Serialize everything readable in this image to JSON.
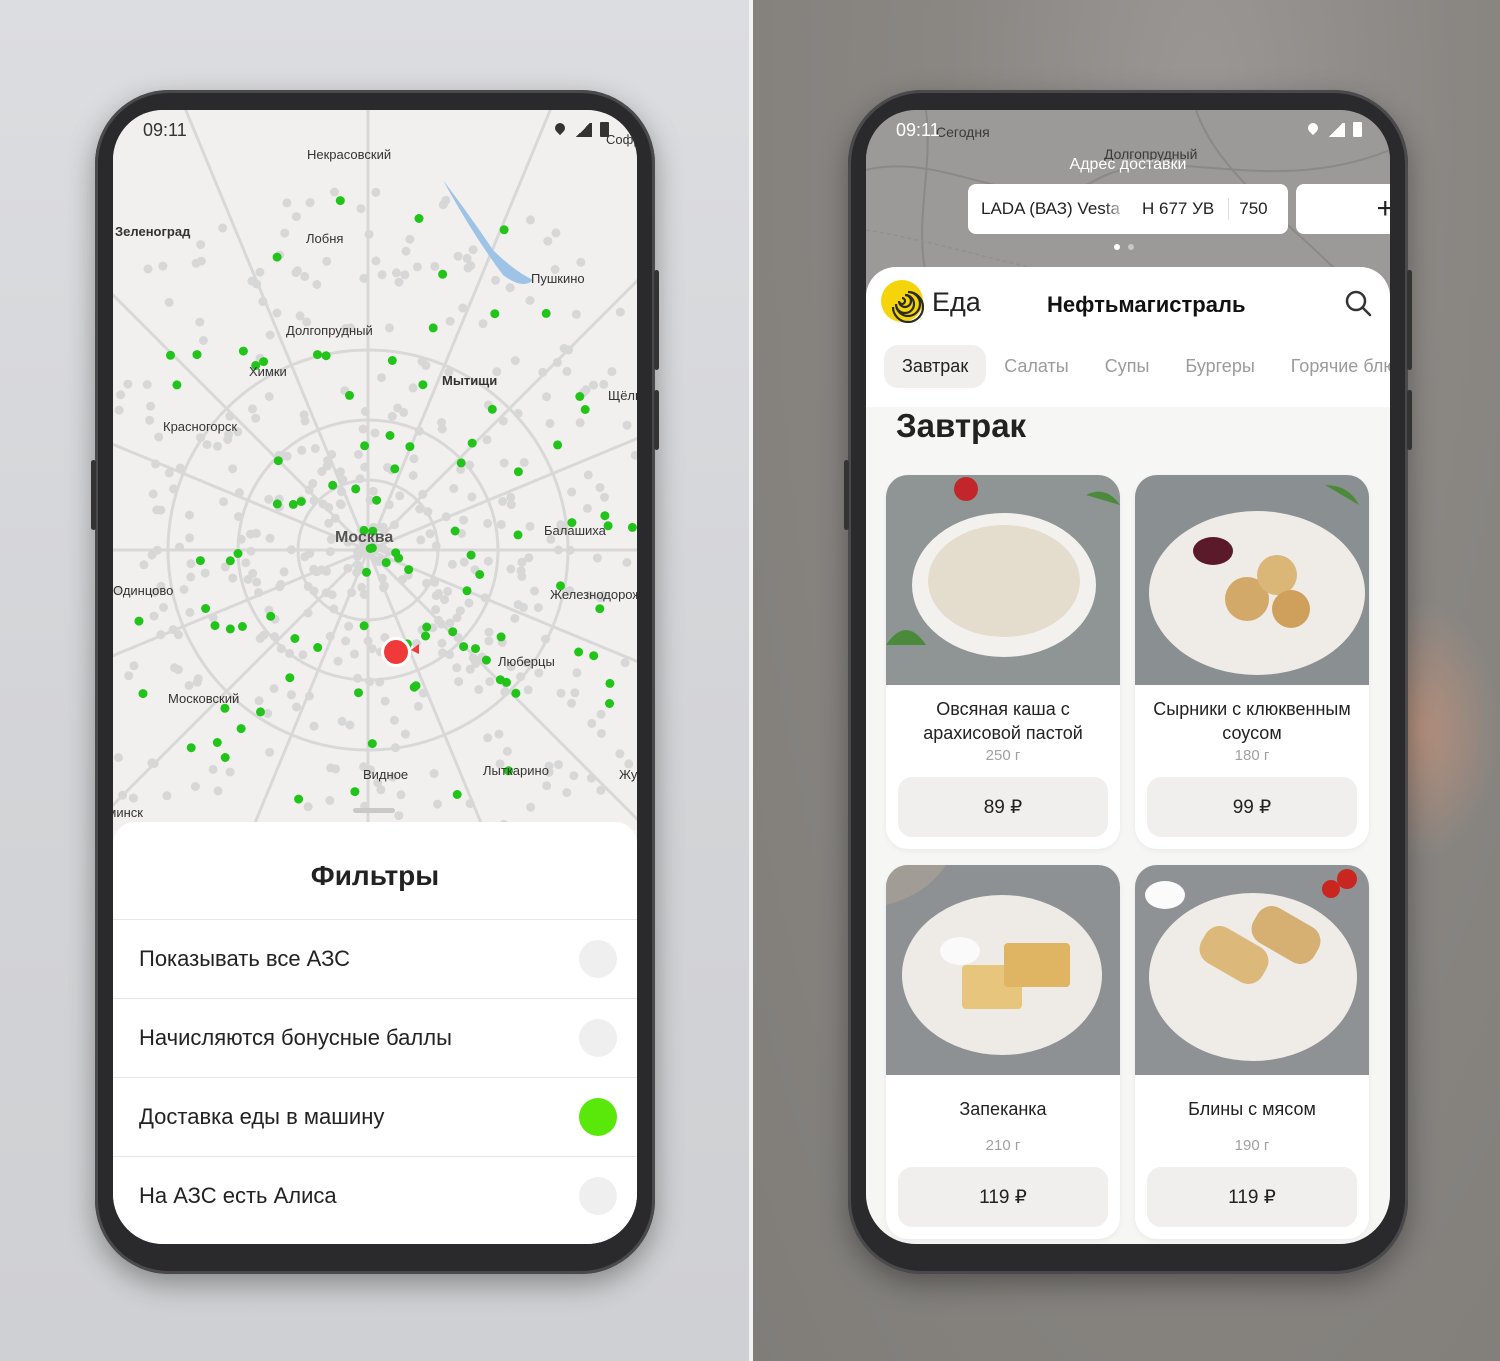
{
  "left_phone": {
    "status": {
      "time": "09:11"
    },
    "map": {
      "labels": [
        "Некрасовский",
        "Зеленоград",
        "Лобня",
        "Пушкино",
        "Долгопрудный",
        "Химки",
        "Мытищи",
        "Красногорск",
        "Москва",
        "Балашиха",
        "Одинцово",
        "Железнодорожный",
        "Люберцы",
        "Московский",
        "Видное",
        "Лыткарино",
        "Софрино",
        "Жуковский",
        "Щёлково",
        "Наро-Фоминск"
      ]
    },
    "filters": {
      "title": "Фильтры",
      "items": [
        {
          "label": "Показывать все АЗС",
          "enabled": false
        },
        {
          "label": "Начисляются бонусные баллы",
          "enabled": false
        },
        {
          "label": "Доставка еды в машину",
          "enabled": true
        },
        {
          "label": "На АЗС есть Алиса",
          "enabled": false
        }
      ]
    }
  },
  "right_phone": {
    "status": {
      "time": "09:11"
    },
    "map": {
      "labels": [
        "Сегодня",
        "Долгопрудный"
      ]
    },
    "delivery": {
      "address_label": "Адрес доставки",
      "car": {
        "name": "LADA (ВАЗ) Vesta",
        "plate": "Н 677 УВ",
        "region": "750"
      },
      "add_symbol": "+"
    },
    "app": {
      "brand": "Еда",
      "station": "Нефтьмагистраль",
      "tabs": [
        "Завтрак",
        "Салаты",
        "Супы",
        "Бургеры",
        "Горячие блюда"
      ],
      "active_tab": "Завтрак",
      "section_title": "Завтрак",
      "items": [
        {
          "name": "Овсяная каша с арахисовой пастой",
          "weight": "250 г",
          "price": "89 ₽"
        },
        {
          "name": "Сырники с клюквенным соусом",
          "weight": "180 г",
          "price": "99 ₽"
        },
        {
          "name": "Запеканка",
          "weight": "210 г",
          "price": "119 ₽"
        },
        {
          "name": "Блины с мясом",
          "weight": "190 г",
          "price": "119 ₽"
        }
      ]
    }
  },
  "colors": {
    "accent_green": "#5ae80a",
    "station_dot": "#22c41a",
    "user_marker": "#f03a3a",
    "eda_yellow": "#f6d40c"
  }
}
